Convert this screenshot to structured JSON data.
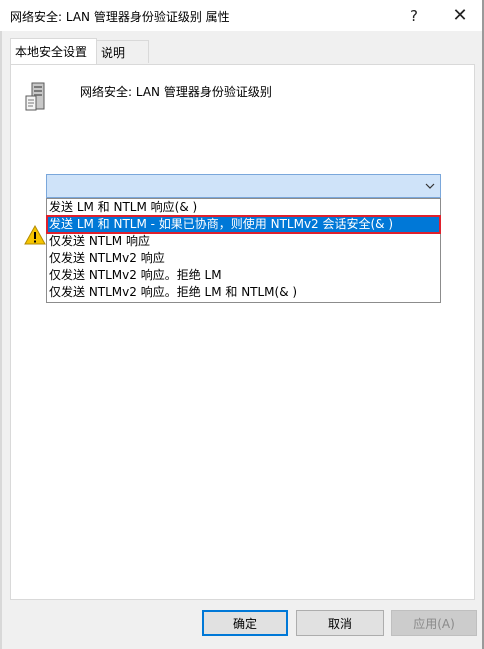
{
  "window": {
    "title": "网络安全: LAN 管理器身份验证级别 属性",
    "help_label": "?",
    "close_label": "✕"
  },
  "tabs": [
    {
      "label": "本地安全设置",
      "active": true
    },
    {
      "label": "说明",
      "active": false
    }
  ],
  "policy": {
    "icon": "server-policy-icon",
    "name": "网络安全: LAN 管理器身份验证级别"
  },
  "combo": {
    "value": "",
    "arrow_icon": "chevron-down-icon"
  },
  "dropdown": {
    "options": [
      "发送 LM 和 NTLM 响应(& )",
      "发送 LM 和 NTLM - 如果已协商，则使用 NTLMv2 会话安全(& )",
      "仅发送 NTLM 响应",
      "仅发送 NTLMv2 响应",
      "仅发送 NTLMv2 响应。拒绝 LM",
      "仅发送 NTLMv2 响应。拒绝 LM 和 NTLM(& )"
    ],
    "selected_index": 1
  },
  "warning": {
    "icon": "warning-icon"
  },
  "buttons": {
    "ok": "确定",
    "cancel": "取消",
    "apply": "应用(A)"
  },
  "colors": {
    "selection": "#0078d7",
    "highlight_outline": "#e0202c",
    "combo_bg": "#cfe3f9"
  }
}
